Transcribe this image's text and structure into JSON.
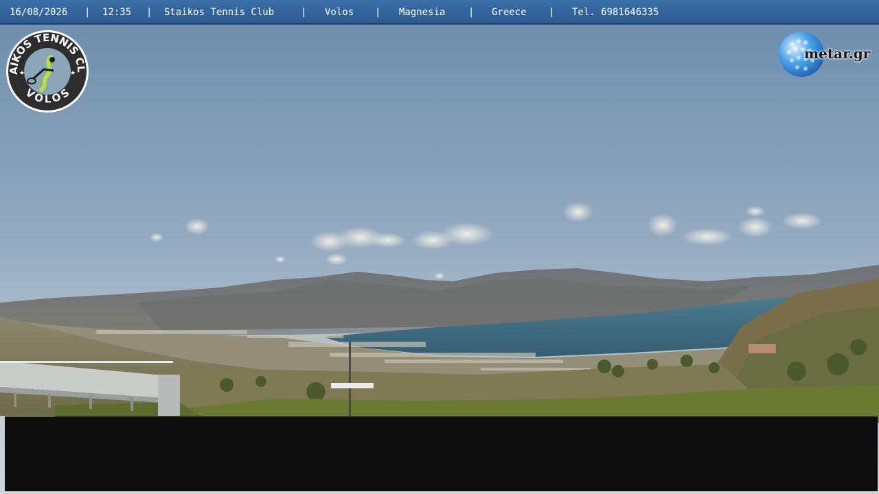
{
  "header": {
    "date": "16/08/2026",
    "time": "12:35",
    "club": "Staikos Tennis Club",
    "city": "Volos",
    "region": "Magnesia",
    "country": "Greece",
    "phone": "Tel. 6981646335",
    "separator": "|"
  },
  "logos": {
    "club_top": "STAIKOS TENNIS CLUB",
    "club_bottom": "VOLOS",
    "metar": "metar.gr"
  },
  "colors": {
    "header_bar": "#2f6199",
    "sky_top": "#6f8fae",
    "sky_horizon": "#c9d3d9",
    "sea": "#3f6b80",
    "overlay_box": "#0d0d0d"
  },
  "icons": {
    "club": "tennis-player-logo-icon",
    "metar": "golf-ball-globe-icon"
  }
}
